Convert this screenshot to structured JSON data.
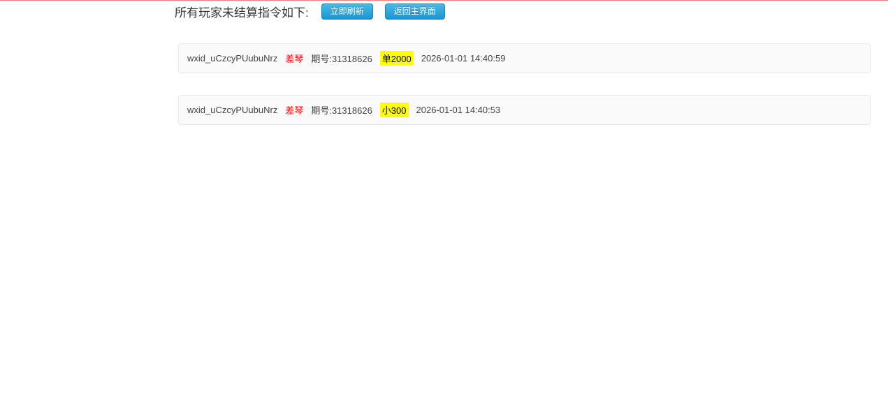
{
  "page": {
    "title": "所有玩家未结算指令如下:"
  },
  "toolbar": {
    "refresh_label": "立即刷新",
    "back_label": "返回主界面"
  },
  "orders": [
    {
      "wxid": "wxid_uCzcyPUubuNrz",
      "nickname": "差琴",
      "period": "期号:31318626",
      "bet": "单2000",
      "time": "2026-01-01 14:40:59"
    },
    {
      "wxid": "wxid_uCzcyPUubuNrz",
      "nickname": "差琴",
      "period": "期号:31318626",
      "bet": "小300",
      "time": "2026-01-01 14:40:53"
    }
  ],
  "colors": {
    "top_accent_line": "#f08080",
    "button_blue_top": "#47b9e9",
    "button_blue_bottom": "#1a96cf",
    "nickname_red": "#ff0000",
    "bet_highlight_yellow": "#ffff00",
    "card_background": "#fafafa",
    "card_border": "#e8e8e8"
  }
}
